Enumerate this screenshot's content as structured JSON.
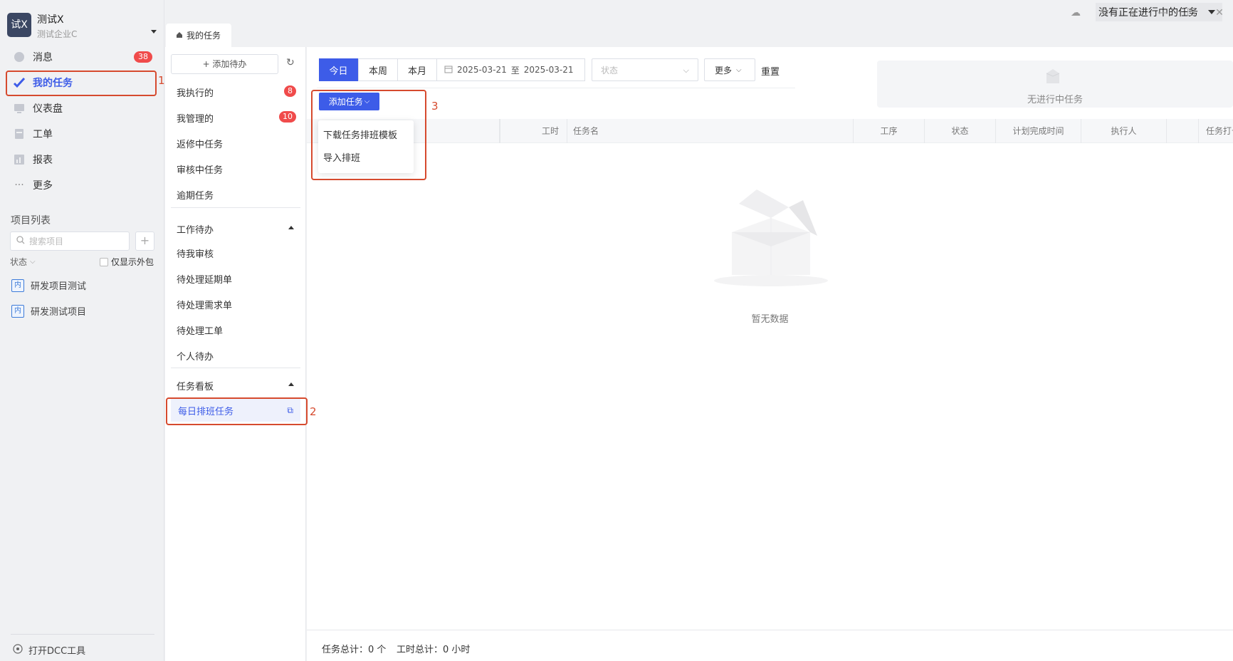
{
  "app": {
    "brand_initials": "试X",
    "name": "测试X",
    "org": "测试企业C"
  },
  "window": {
    "task_status": "没有正在进行中的任务"
  },
  "nav": [
    {
      "label": "消息",
      "badge": "38",
      "icon": "message-icon"
    },
    {
      "label": "我的任务",
      "badge": "",
      "icon": "task-check-icon",
      "active": true
    },
    {
      "label": "仪表盘",
      "badge": "",
      "icon": "dashboard-icon"
    },
    {
      "label": "工单",
      "badge": "",
      "icon": "work-order-icon"
    },
    {
      "label": "报表",
      "badge": "",
      "icon": "report-icon"
    },
    {
      "label": "更多",
      "badge": "",
      "icon": "more-dots-icon"
    }
  ],
  "projects": {
    "title": "项目列表",
    "search_placeholder": "搜索项目",
    "status_label": "状态",
    "outsource_label": "仅显示外包",
    "items": [
      {
        "tag": "内",
        "name": "研发项目测试"
      },
      {
        "tag": "内",
        "name": "研发测试项目"
      }
    ]
  },
  "footer_tool": "打开DCC工具",
  "tab": {
    "label": "我的任务"
  },
  "mid": {
    "add_todo": "+ 添加待办",
    "items": [
      {
        "label": "我执行的",
        "badge": "8"
      },
      {
        "label": "我管理的",
        "badge": "10"
      },
      {
        "label": "返修中任务",
        "badge": ""
      },
      {
        "label": "审核中任务",
        "badge": ""
      },
      {
        "label": "逾期任务",
        "badge": ""
      }
    ],
    "group_work": "工作待办",
    "work_items": [
      "待我审核",
      "待处理延期单",
      "待处理需求单",
      "待处理工单",
      "个人待办"
    ],
    "group_board": "任务看板",
    "board_item": "每日排班任务"
  },
  "toolbar": {
    "today": "今日",
    "week": "本周",
    "month": "本月",
    "date_from": "2025-03-21",
    "date_sep": "至",
    "date_to": "2025-03-21",
    "status_placeholder": "状态",
    "more": "更多",
    "reset": "重置",
    "add_task": "添加任务"
  },
  "no_progress": "无进行中任务",
  "dropdown": [
    "下载任务排班模板",
    "导入排班"
  ],
  "table": {
    "columns": [
      "工时",
      "任务名",
      "工序",
      "状态",
      "计划完成时间",
      "执行人",
      "任务打卡"
    ],
    "empty": "暂无数据"
  },
  "summary": {
    "task_total": "任务总计：0 个",
    "hours_total": "工时总计：0 小时"
  },
  "annotations": [
    "1",
    "2",
    "3"
  ],
  "colors": {
    "accent": "#3d5ce8",
    "badge": "#f04b4b",
    "annotation": "#d64a2e"
  }
}
